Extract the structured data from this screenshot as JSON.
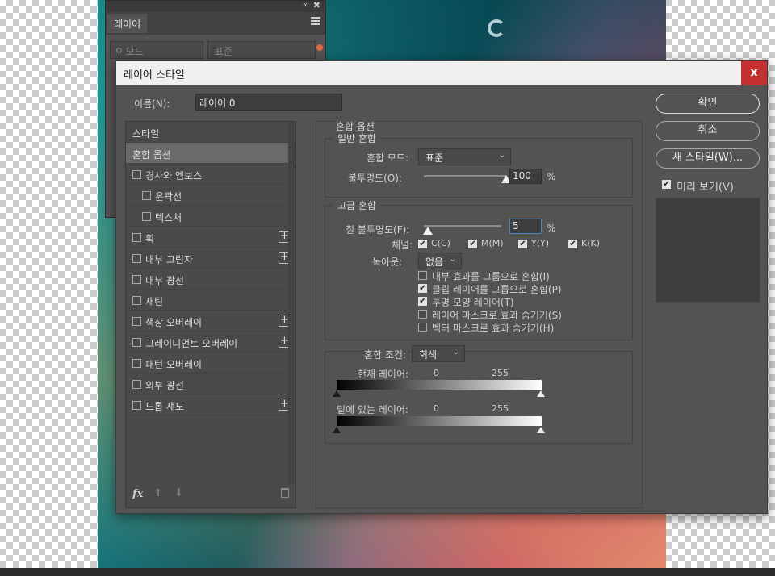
{
  "layers_panel": {
    "tab_label": "레이어",
    "filter_placeholder": "모드",
    "blend_mode": "표준",
    "collapse_icon": "«",
    "close_icon": "✖"
  },
  "dialog": {
    "title": "레이어 스타일",
    "close_icon": "x",
    "name_label": "이름(N):",
    "name_value": "레이어 0",
    "buttons": {
      "ok": "확인",
      "cancel": "취소",
      "new_style": "새 스타일(W)...",
      "preview_label": "미리 보기(V)"
    },
    "styles_list": [
      {
        "label": "스타일",
        "checkbox": false,
        "plus": false,
        "indent": 0,
        "selected": false
      },
      {
        "label": "혼합 옵션",
        "checkbox": false,
        "plus": false,
        "indent": 0,
        "selected": true
      },
      {
        "label": "경사와 엠보스",
        "checkbox": true,
        "plus": false,
        "indent": 0,
        "selected": false
      },
      {
        "label": "윤곽선",
        "checkbox": true,
        "plus": false,
        "indent": 1,
        "selected": false
      },
      {
        "label": "텍스처",
        "checkbox": true,
        "plus": false,
        "indent": 1,
        "selected": false
      },
      {
        "label": "획",
        "checkbox": true,
        "plus": true,
        "indent": 0,
        "selected": false
      },
      {
        "label": "내부 그림자",
        "checkbox": true,
        "plus": true,
        "indent": 0,
        "selected": false
      },
      {
        "label": "내부 광선",
        "checkbox": true,
        "plus": false,
        "indent": 0,
        "selected": false
      },
      {
        "label": "새틴",
        "checkbox": true,
        "plus": false,
        "indent": 0,
        "selected": false
      },
      {
        "label": "색상 오버레이",
        "checkbox": true,
        "plus": true,
        "indent": 0,
        "selected": false
      },
      {
        "label": "그레이디언트 오버레이",
        "checkbox": true,
        "plus": true,
        "indent": 0,
        "selected": false
      },
      {
        "label": "패턴 오버레이",
        "checkbox": true,
        "plus": false,
        "indent": 0,
        "selected": false
      },
      {
        "label": "외부 광선",
        "checkbox": true,
        "plus": false,
        "indent": 0,
        "selected": false
      },
      {
        "label": "드롭 섀도",
        "checkbox": true,
        "plus": true,
        "indent": 0,
        "selected": false
      }
    ],
    "footer_icons": {
      "fx": "fx",
      "up": "⬆",
      "down": "⬇"
    },
    "blending": {
      "section_title": "혼합 옵션",
      "general": {
        "title": "일반 혼합",
        "blend_mode_label": "혼합 모드:",
        "blend_mode_value": "표준",
        "opacity_label": "불투명도(O):",
        "opacity_value": "100",
        "opacity_unit": "%",
        "opacity_level": 100
      },
      "advanced": {
        "title": "고급 혼합",
        "fill_opacity_label": "칠 불투명도(F):",
        "fill_opacity_value": "5",
        "fill_opacity_unit": "%",
        "fill_opacity_level": 5,
        "channels_label": "채널:",
        "channels": [
          {
            "label": "C(C)",
            "checked": true
          },
          {
            "label": "M(M)",
            "checked": true
          },
          {
            "label": "Y(Y)",
            "checked": true
          },
          {
            "label": "K(K)",
            "checked": true
          }
        ],
        "knockout_label": "녹아웃:",
        "knockout_value": "없음",
        "options": [
          {
            "label": "내부 효과를 그룹으로 혼합(I)",
            "checked": false
          },
          {
            "label": "클립 레이어를 그룹으로 혼합(P)",
            "checked": true
          },
          {
            "label": "투명 모양 레이어(T)",
            "checked": true
          },
          {
            "label": "레이어 마스크로 효과 숨기기(S)",
            "checked": false
          },
          {
            "label": "벡터 마스크로 효과 숨기기(H)",
            "checked": false
          }
        ]
      },
      "blend_if": {
        "label": "혼합 조건:",
        "value": "회색",
        "this_layer_label": "현재 레이어:",
        "this_layer_min": "0",
        "this_layer_max": "255",
        "underlying_label": "밑에 있는 레이어:",
        "underlying_min": "0",
        "underlying_max": "255"
      }
    }
  }
}
